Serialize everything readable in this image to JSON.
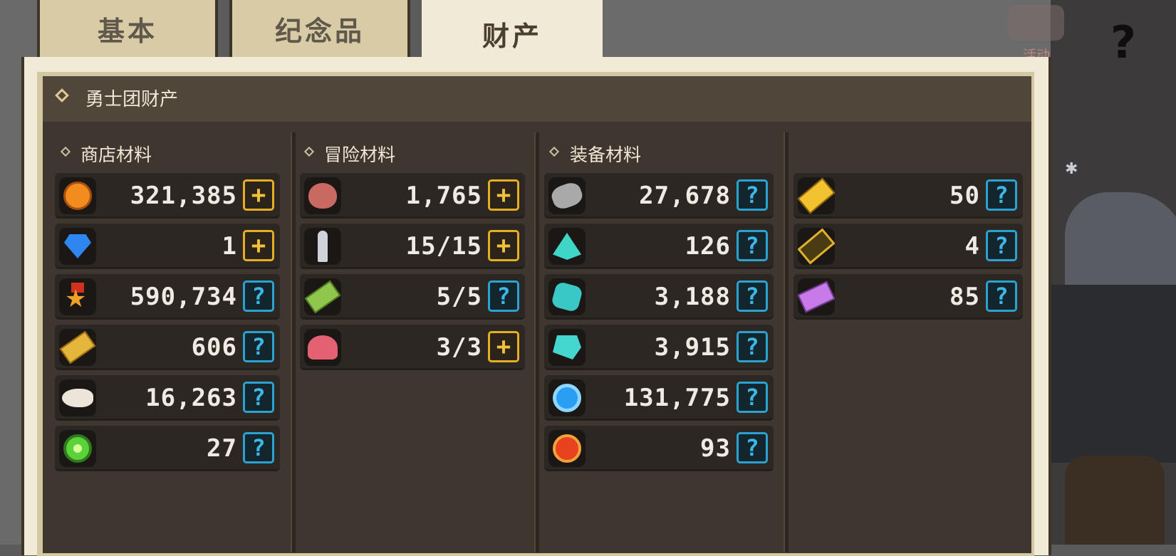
{
  "tabs": [
    {
      "label": "基本",
      "active": false
    },
    {
      "label": "纪念品",
      "active": false
    },
    {
      "label": "财产",
      "active": true
    }
  ],
  "event_label": "活动",
  "panel_title": "勇士团财产",
  "colors": {
    "plus_button": "#e6ae25",
    "help_button": "#2aa3d2",
    "panel_bg": "#3f372f",
    "tab_active": "#f1ead6"
  },
  "sections": {
    "shop": {
      "title": "商店材料",
      "items": [
        {
          "icon": "gold-coin-icon",
          "value": "321,385",
          "button": "plus"
        },
        {
          "icon": "blue-gem-icon",
          "value": "1",
          "button": "plus"
        },
        {
          "icon": "medal-icon",
          "value": "590,734",
          "button": "help"
        },
        {
          "icon": "gold-ticket-icon",
          "value": "606",
          "button": "help"
        },
        {
          "icon": "fish-icon",
          "value": "16,263",
          "button": "help"
        },
        {
          "icon": "green-eye-icon",
          "value": "27",
          "button": "help"
        }
      ]
    },
    "adventure": {
      "title": "冒险材料",
      "items": [
        {
          "icon": "meat-icon",
          "value": "1,765",
          "button": "plus"
        },
        {
          "icon": "key-icon",
          "value": "15/15",
          "button": "plus"
        },
        {
          "icon": "green-ticket-icon",
          "value": "5/5",
          "button": "help"
        },
        {
          "icon": "shell-icon",
          "value": "3/3",
          "button": "plus"
        }
      ]
    },
    "equipment": {
      "title": "装备材料",
      "items": [
        {
          "icon": "ore-icon",
          "value": "27,678",
          "button": "help"
        },
        {
          "icon": "crystal-pile-icon",
          "value": "126",
          "button": "help"
        },
        {
          "icon": "crystal-icon",
          "value": "3,188",
          "button": "help"
        },
        {
          "icon": "big-crystal-icon",
          "value": "3,915",
          "button": "help"
        },
        {
          "icon": "blue-orb-icon",
          "value": "131,775",
          "button": "help"
        },
        {
          "icon": "red-orb-icon",
          "value": "93",
          "button": "help"
        }
      ]
    },
    "equipment_extra": {
      "items": [
        {
          "icon": "gold-ticket-icon",
          "value": "50",
          "button": "help"
        },
        {
          "icon": "dark-ticket-icon",
          "value": "4",
          "button": "help"
        },
        {
          "icon": "purple-ticket-icon",
          "value": "85",
          "button": "help"
        }
      ]
    }
  },
  "button_glyphs": {
    "plus": "+",
    "help": "?"
  }
}
